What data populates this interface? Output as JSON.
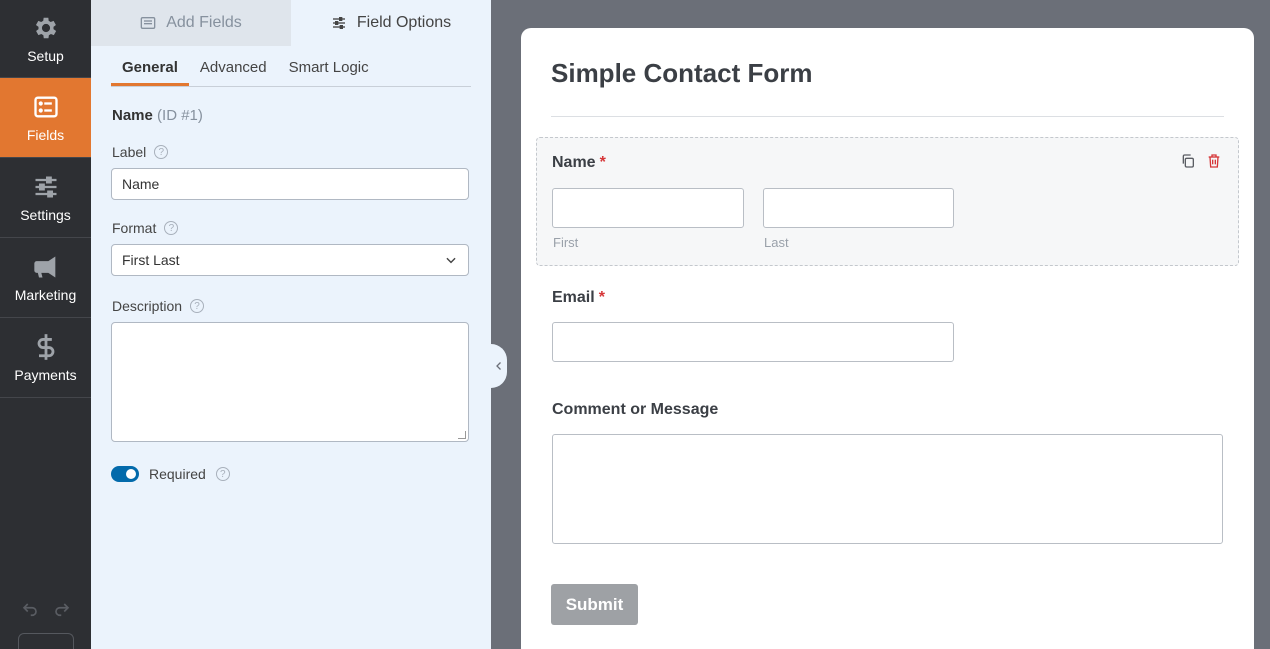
{
  "nav": {
    "items": [
      {
        "label": "Setup",
        "icon": "gear-icon"
      },
      {
        "label": "Fields",
        "icon": "fields-list-icon"
      },
      {
        "label": "Settings",
        "icon": "sliders-icon"
      },
      {
        "label": "Marketing",
        "icon": "megaphone-icon"
      },
      {
        "label": "Payments",
        "icon": "dollar-icon"
      }
    ],
    "active": "Fields"
  },
  "panel": {
    "tabs": [
      {
        "label": "Add Fields",
        "icon": "add-fields-icon"
      },
      {
        "label": "Field Options",
        "icon": "field-options-icon"
      }
    ],
    "active_tab": "Field Options",
    "sub_tabs": [
      "General",
      "Advanced",
      "Smart Logic"
    ],
    "active_sub_tab": "General",
    "field_name": "Name",
    "field_id": "(ID #1)",
    "label_caption": "Label",
    "label_value": "Name",
    "format_caption": "Format",
    "format_value": "First Last",
    "description_caption": "Description",
    "description_value": "",
    "required_caption": "Required",
    "required_on": true,
    "help_glyph": "?"
  },
  "form": {
    "title": "Simple Contact Form",
    "fields": [
      {
        "label": "Name",
        "required": true,
        "sub_labels": [
          "First",
          "Last"
        ]
      },
      {
        "label": "Email",
        "required": true
      },
      {
        "label": "Comment or Message",
        "required": false
      }
    ],
    "required_mark": "*",
    "submit_label": "Submit"
  },
  "colors": {
    "accent": "#e27730",
    "nav_bg": "#2d2f33",
    "toggle_on": "#036aab",
    "required": "#d63638"
  }
}
